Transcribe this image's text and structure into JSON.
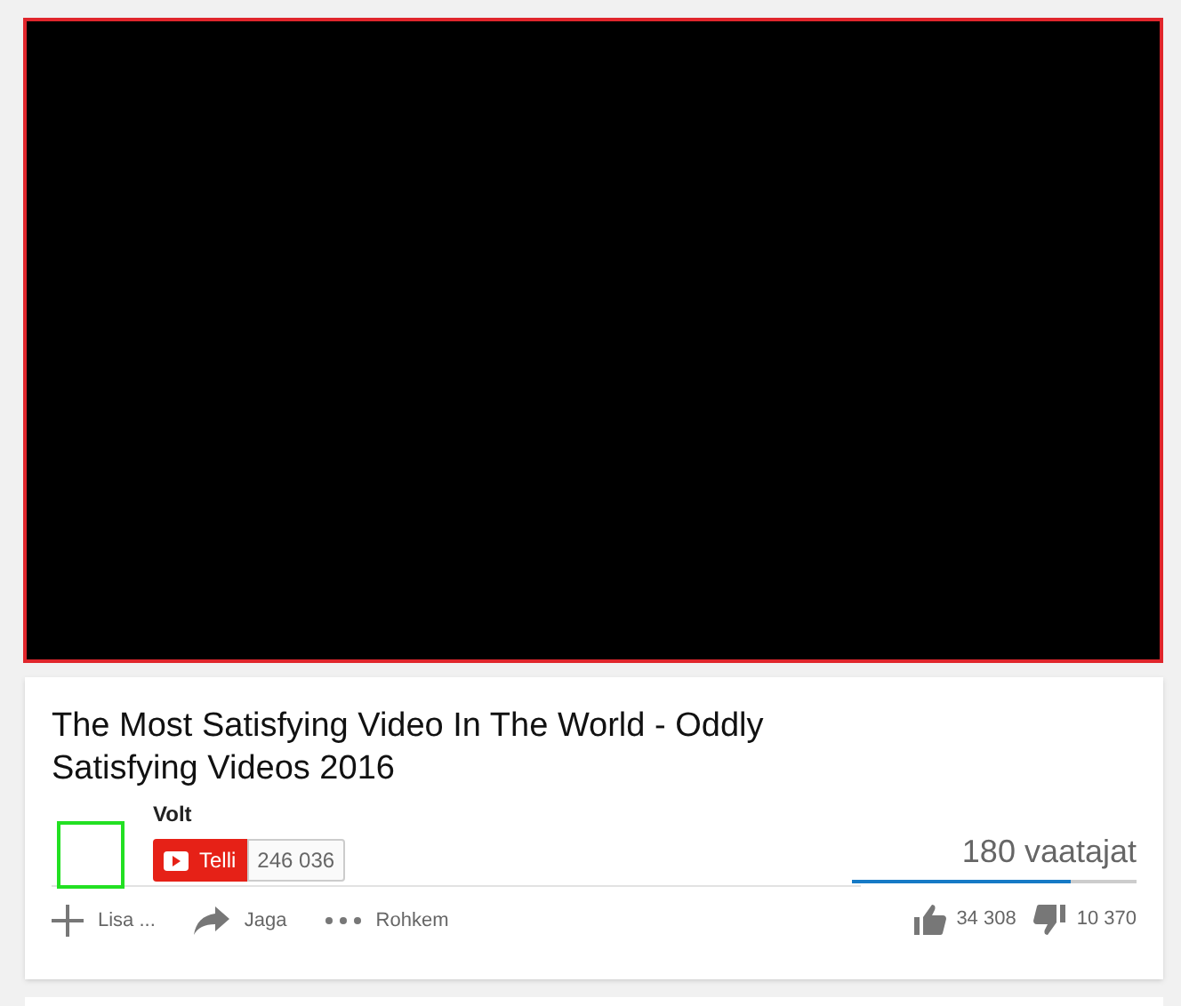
{
  "video": {
    "title": "The Most Satisfying Video In The World - Oddly Satisfying Videos 2016"
  },
  "channel": {
    "name": "Volt",
    "subscribe_label": "Telli",
    "subscriber_count": "246 036"
  },
  "views": "180 vaatajat",
  "sentiment": {
    "level": 0.77
  },
  "actions": [
    {
      "kind": "add",
      "label": "Lisa ..."
    },
    {
      "kind": "share",
      "label": "Jaga"
    },
    {
      "kind": "more",
      "label": "Rohkem"
    }
  ],
  "likes": "34 308",
  "dislikes": "10 370"
}
